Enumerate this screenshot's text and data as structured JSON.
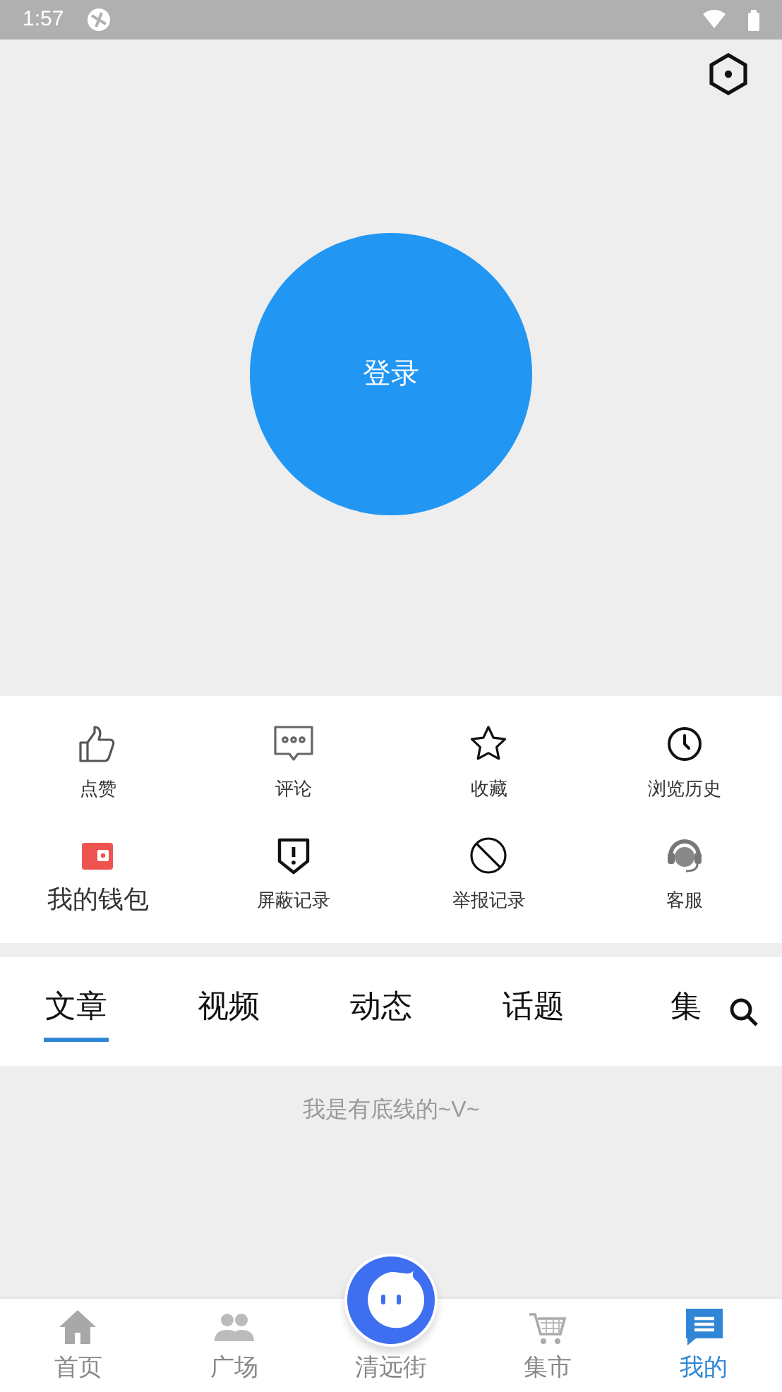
{
  "status_bar": {
    "time": "1:57"
  },
  "login": {
    "label": "登录"
  },
  "shortcuts": [
    {
      "label": "点赞",
      "kind": "normal"
    },
    {
      "label": "评论",
      "kind": "normal"
    },
    {
      "label": "收藏",
      "kind": "normal"
    },
    {
      "label": "浏览历史",
      "kind": "normal"
    },
    {
      "label": "我的钱包",
      "kind": "large"
    },
    {
      "label": "屏蔽记录",
      "kind": "normal"
    },
    {
      "label": "举报记录",
      "kind": "normal"
    },
    {
      "label": "客服",
      "kind": "normal"
    }
  ],
  "tabs": [
    {
      "label": "文章",
      "selected": true
    },
    {
      "label": "视频",
      "selected": false
    },
    {
      "label": "动态",
      "selected": false
    },
    {
      "label": "话题",
      "selected": false
    },
    {
      "label": "集",
      "selected": false
    }
  ],
  "end_note": "我是有底线的~V~",
  "bottom_nav": [
    {
      "label": "首页",
      "selected": false,
      "kind": "normal"
    },
    {
      "label": "广场",
      "selected": false,
      "kind": "normal"
    },
    {
      "label": "清远街",
      "selected": false,
      "kind": "center"
    },
    {
      "label": "集市",
      "selected": false,
      "kind": "normal"
    },
    {
      "label": "我的",
      "selected": true,
      "kind": "normal"
    }
  ]
}
